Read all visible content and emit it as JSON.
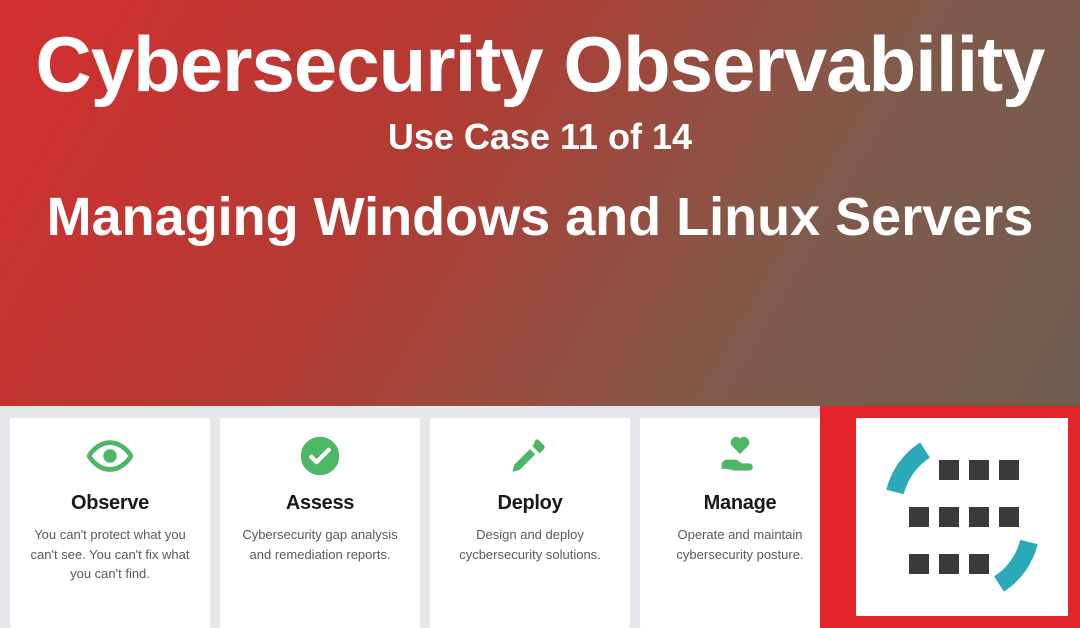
{
  "hero": {
    "title": "Cybersecurity Observability",
    "subtitle": "Use Case 11 of 14",
    "heading": "Managing Windows and Linux Servers"
  },
  "cards": [
    {
      "icon": "eye-icon",
      "title": "Observe",
      "desc": "You can't protect what you can't see. You can't fix what you can't find."
    },
    {
      "icon": "check-icon",
      "title": "Assess",
      "desc": "Cybersecurity gap analysis and remediation reports."
    },
    {
      "icon": "hammer-icon",
      "title": "Deploy",
      "desc": "Design and deploy cycbersecurity solutions."
    },
    {
      "icon": "heart-hand-icon",
      "title": "Manage",
      "desc": "Operate and maintain cybersecurity posture."
    }
  ],
  "colors": {
    "green": "#4db766",
    "teal": "#2aa9b8",
    "dark": "#3a3a3a"
  }
}
